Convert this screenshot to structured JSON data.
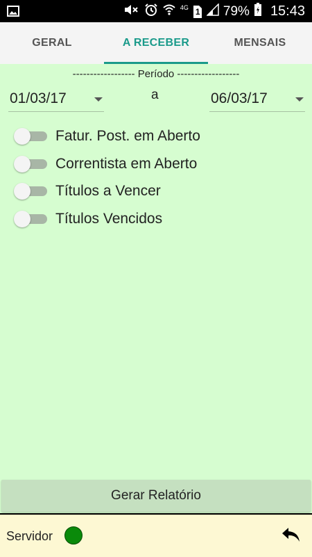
{
  "status_bar": {
    "battery": "79%",
    "time": "15:43",
    "signal_label": "4G",
    "sim_slot": "1",
    "icons": [
      "image-icon",
      "mute-icon",
      "alarm-icon",
      "wifi-icon",
      "sim-icon",
      "signal-icon",
      "battery-icon"
    ]
  },
  "tabs": [
    {
      "label": "GERAL",
      "active": false
    },
    {
      "label": "A RECEBER",
      "active": true
    },
    {
      "label": "MENSAIS",
      "active": false
    }
  ],
  "period": {
    "title": "------------------ Período ------------------",
    "from": "01/03/17",
    "separator": "a",
    "to": "06/03/17"
  },
  "filters": [
    {
      "label": "Fatur. Post. em Aberto",
      "on": false
    },
    {
      "label": "Correntista em Aberto",
      "on": false
    },
    {
      "label": "Títulos a Vencer",
      "on": false
    },
    {
      "label": "Títulos Vencidos",
      "on": false
    }
  ],
  "actions": {
    "generate_label": "Gerar Relatório"
  },
  "footer": {
    "server_label": "Servidor",
    "server_status_color": "#0a8a0a"
  },
  "colors": {
    "accent": "#1a9a8a",
    "content_bg": "#d6fdd0",
    "footer_bg": "#fdf8d3"
  }
}
